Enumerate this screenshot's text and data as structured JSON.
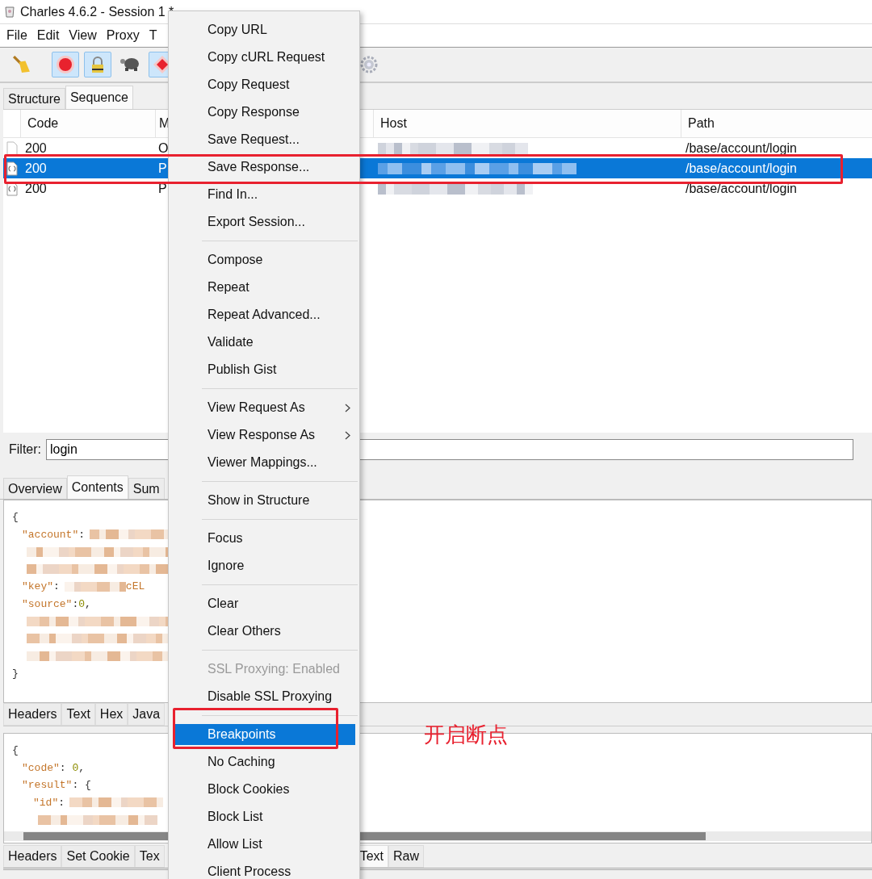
{
  "window": {
    "title": "Charles 4.6.2 - Session 1 *"
  },
  "menubar": [
    "File",
    "Edit",
    "View",
    "Proxy",
    "T"
  ],
  "toolbar": [
    {
      "kind": "broom",
      "on": false
    },
    {
      "kind": "record",
      "on": true
    },
    {
      "kind": "lock",
      "on": true
    },
    {
      "kind": "turtle",
      "on": false
    },
    {
      "kind": "stop",
      "on": true
    },
    {
      "kind": "gear",
      "on": false
    }
  ],
  "view_tabs": [
    {
      "label": "Structure",
      "selected": false
    },
    {
      "label": "Sequence",
      "selected": true
    }
  ],
  "table": {
    "columns": [
      "Code",
      "M",
      "Host",
      "Path"
    ],
    "rows": [
      {
        "kind": "doc",
        "code": "200",
        "method": "O",
        "path": "/base/account/login",
        "selected": false
      },
      {
        "kind": "json",
        "code": "200",
        "method": "P",
        "path": "/base/account/login",
        "selected": true
      },
      {
        "kind": "json",
        "code": "200",
        "method": "P",
        "path": "/base/account/login",
        "selected": false
      }
    ]
  },
  "filter": {
    "label": "Filter:",
    "value": "login"
  },
  "detail_tabs": [
    {
      "label": "Overview",
      "selected": false
    },
    {
      "label": "Contents",
      "selected": true
    },
    {
      "label": "Sum",
      "selected": false
    }
  ],
  "request_body": [
    {
      "kind": "brace",
      "text": "{"
    },
    {
      "kind": "member",
      "key": "\"account\"",
      "sep": ":",
      "redacted": true
    },
    {
      "kind": "member",
      "redacted": true
    },
    {
      "kind": "member",
      "redacted": true
    },
    {
      "kind": "member",
      "key": "\"key\"",
      "sep": ":",
      "redacted": true,
      "value": {
        "kind": "string",
        "text": "cEL"
      }
    },
    {
      "kind": "member",
      "key": "\"source\"",
      "sep": ":",
      "value": {
        "kind": "number",
        "text": "0"
      },
      "trail": ","
    },
    {
      "kind": "member",
      "redacted": true
    },
    {
      "kind": "member",
      "redacted": true
    },
    {
      "kind": "member",
      "redacted": true
    },
    {
      "kind": "brace",
      "text": "}"
    }
  ],
  "request_tabs": [
    {
      "label": "Headers",
      "selected": false
    },
    {
      "label": "Text",
      "selected": false
    },
    {
      "label": "Hex",
      "selected": false
    },
    {
      "label": "Java",
      "selected": false
    }
  ],
  "response_body": [
    {
      "kind": "brace",
      "text": "{"
    },
    {
      "kind": "member",
      "key": "\"code\"",
      "sep": ":",
      "value": {
        "kind": "number",
        "text": "0"
      },
      "trail": ","
    },
    {
      "kind": "member",
      "key": "\"result\"",
      "sep": ":",
      "value": {
        "kind": "punct",
        "text": "{"
      }
    },
    {
      "kind": "nested",
      "key": "\"id\"",
      "sep": ":",
      "redacted": true
    },
    {
      "kind": "nested",
      "redacted": true
    }
  ],
  "response_tabs": [
    {
      "label": "Headers",
      "selected": false
    },
    {
      "label": "Set Cookie",
      "selected": false
    },
    {
      "label": "Tex",
      "selected": false
    },
    {
      "label": "Text",
      "selected": true
    },
    {
      "label": "Raw",
      "selected": false
    }
  ],
  "context_menu": [
    {
      "kind": "item",
      "label": "Copy URL",
      "disabled": false,
      "selected": false
    },
    {
      "kind": "item",
      "label": "Copy cURL Request",
      "disabled": false,
      "selected": false
    },
    {
      "kind": "item",
      "label": "Copy Request",
      "disabled": false,
      "selected": false
    },
    {
      "kind": "item",
      "label": "Copy Response",
      "disabled": false,
      "selected": false
    },
    {
      "kind": "item",
      "label": "Save Request...",
      "disabled": false,
      "selected": false
    },
    {
      "kind": "item",
      "label": "Save Response...",
      "disabled": false,
      "selected": false
    },
    {
      "kind": "item",
      "label": "Find In...",
      "disabled": false,
      "selected": false
    },
    {
      "kind": "item",
      "label": "Export Session...",
      "disabled": false,
      "selected": false
    },
    {
      "kind": "separator"
    },
    {
      "kind": "item",
      "label": "Compose",
      "disabled": false,
      "selected": false
    },
    {
      "kind": "item",
      "label": "Repeat",
      "disabled": false,
      "selected": false
    },
    {
      "kind": "item",
      "label": "Repeat Advanced...",
      "disabled": false,
      "selected": false
    },
    {
      "kind": "item",
      "label": "Validate",
      "disabled": false,
      "selected": false
    },
    {
      "kind": "item",
      "label": "Publish Gist",
      "disabled": false,
      "selected": false
    },
    {
      "kind": "separator"
    },
    {
      "kind": "submenu",
      "label": "View Request As",
      "disabled": false,
      "selected": false
    },
    {
      "kind": "submenu",
      "label": "View Response As",
      "disabled": false,
      "selected": false
    },
    {
      "kind": "item",
      "label": "Viewer Mappings...",
      "disabled": false,
      "selected": false
    },
    {
      "kind": "separator"
    },
    {
      "kind": "item",
      "label": "Show in Structure",
      "disabled": false,
      "selected": false
    },
    {
      "kind": "separator"
    },
    {
      "kind": "item",
      "label": "Focus",
      "disabled": false,
      "selected": false
    },
    {
      "kind": "item",
      "label": "Ignore",
      "disabled": false,
      "selected": false
    },
    {
      "kind": "separator"
    },
    {
      "kind": "item",
      "label": "Clear",
      "disabled": false,
      "selected": false
    },
    {
      "kind": "item",
      "label": "Clear Others",
      "disabled": false,
      "selected": false
    },
    {
      "kind": "separator"
    },
    {
      "kind": "item",
      "label": "SSL Proxying: Enabled",
      "disabled": true,
      "selected": false
    },
    {
      "kind": "item",
      "label": "Disable SSL Proxying",
      "disabled": false,
      "selected": false
    },
    {
      "kind": "separator"
    },
    {
      "kind": "item",
      "label": "Breakpoints",
      "disabled": false,
      "selected": true
    },
    {
      "kind": "item",
      "label": "No Caching",
      "disabled": false,
      "selected": false
    },
    {
      "kind": "item",
      "label": "Block Cookies",
      "disabled": false,
      "selected": false
    },
    {
      "kind": "item",
      "label": "Block List",
      "disabled": false,
      "selected": false
    },
    {
      "kind": "item",
      "label": "Allow List",
      "disabled": false,
      "selected": false
    },
    {
      "kind": "item",
      "label": "Client Process",
      "disabled": false,
      "selected": false
    }
  ],
  "annotation": {
    "text": "开启断点"
  }
}
